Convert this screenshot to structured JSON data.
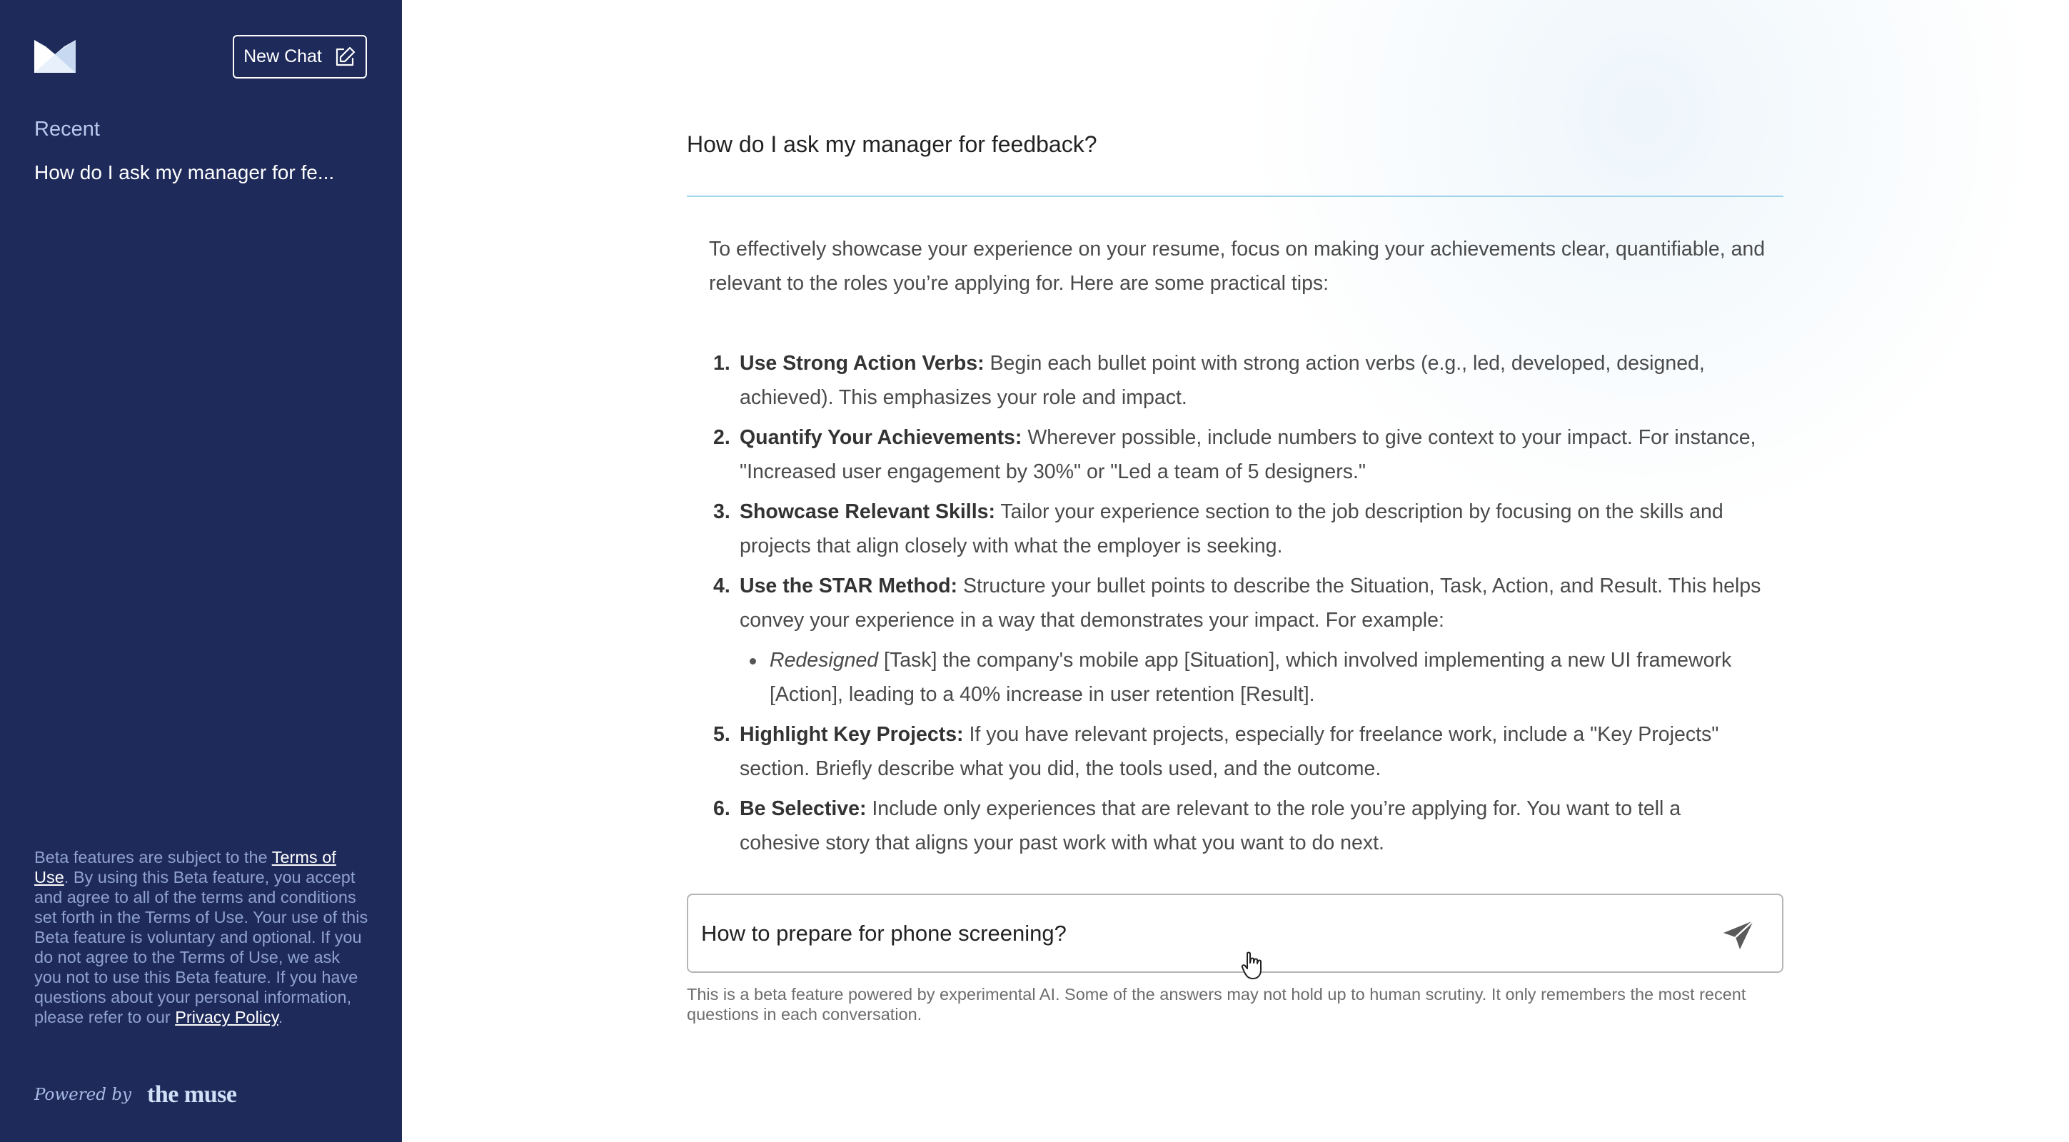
{
  "sidebar": {
    "new_chat_label": "New Chat",
    "recent_heading": "Recent",
    "recent_items": [
      "How do I ask my manager for fe..."
    ],
    "disclaimer": {
      "before_terms": "Beta features are subject to the ",
      "terms_link": "Terms of Use",
      "middle": ". By using this Beta feature, you accept and agree to all of the terms and conditions set forth in the Terms of Use. Your use of this Beta feature is voluntary and optional. If you do not agree to the Terms of Use, we ask you not to use this Beta feature. If you have questions about your personal information, please refer to our ",
      "privacy_link": "Privacy Policy",
      "end": "."
    },
    "powered_by": "Powered by",
    "brand": "the muse"
  },
  "conversation": {
    "question": "How do I ask my manager for feedback?",
    "intro": "To effectively showcase your experience on your resume, focus on making your achievements clear, quantifiable, and relevant to the roles you’re applying for. Here are some practical tips:",
    "tips": [
      {
        "num": "1.",
        "title": "Use Strong Action Verbs:",
        "text": " Begin each bullet point with strong action verbs (e.g., led, developed, designed, achieved). This emphasizes your role and impact."
      },
      {
        "num": "2.",
        "title": "Quantify Your Achievements:",
        "text": " Wherever possible, include numbers to give context to your impact. For instance, \"Increased user engagement by 30%\" or \"Led a team of 5 designers.\""
      },
      {
        "num": "3.",
        "title": "Showcase Relevant Skills:",
        "text": " Tailor your experience section to the job description by focusing on the skills and projects that align closely with what the employer is seeking."
      },
      {
        "num": "4.",
        "title": "Use the STAR Method:",
        "text": " Structure your bullet points to describe the Situation, Task, Action, and Result. This helps convey your experience in a way that demonstrates your impact. For example:"
      },
      {
        "num": "5.",
        "title": "Highlight Key Projects:",
        "text": " If you have relevant projects, especially for freelance work, include a \"Key Projects\" section. Briefly describe what you did, the tools used, and the outcome."
      },
      {
        "num": "6.",
        "title": "Be Selective:",
        "text": " Include only experiences that are relevant to the role you’re applying for. You want to tell a cohesive story that aligns your past work with what you want to do next."
      }
    ],
    "star_example": {
      "italic": "Redesigned",
      "rest": " [Task] the company's mobile app [Situation], which involved implementing a new UI framework [Action], leading to a 40% increase in user retention [Result]."
    }
  },
  "composer": {
    "input_value": "How to prepare for phone screening?",
    "beta_note": "This is a beta feature powered by experimental AI. Some of the answers may not hold up to human scrutiny. It only remembers the most recent questions in each conversation."
  },
  "colors": {
    "sidebar_bg": "#1e2a5a",
    "divider": "#9ed3ea",
    "brand_text": "#cfe0f7"
  },
  "icons": [
    "muse-logo-icon",
    "edit-icon",
    "send-icon",
    "hand-pointer-icon"
  ]
}
